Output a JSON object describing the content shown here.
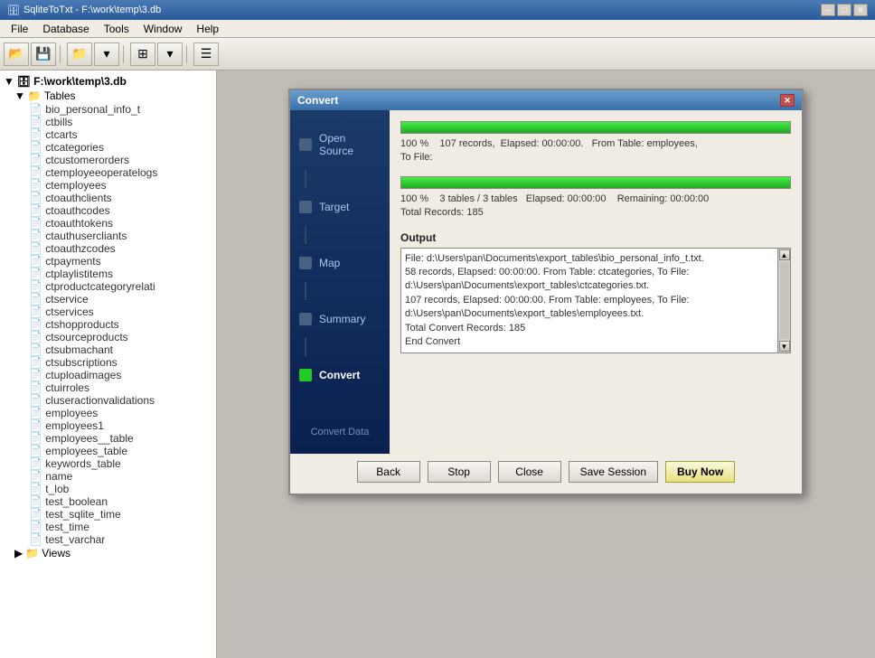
{
  "app": {
    "title": "SqliteToTxt - F:\\work\\temp\\3.db",
    "icon": "🗄"
  },
  "titlebar": {
    "minimize_label": "─",
    "maximize_label": "□",
    "close_label": "✕"
  },
  "menu": {
    "items": [
      "File",
      "Database",
      "Tools",
      "Window",
      "Help"
    ]
  },
  "toolbar": {
    "buttons": [
      "open",
      "save",
      "folder",
      "grid"
    ]
  },
  "tree": {
    "db_label": "F:\\work\\temp\\3.db",
    "tables_label": "Tables",
    "tables": [
      "bio_personal_info_t",
      "ctbills",
      "ctcarts",
      "ctcategories",
      "ctcustomerorders",
      "ctemployeeoperatelogs",
      "ctemployees",
      "ctoauthclients",
      "ctoauthcodes",
      "ctoauthtokens",
      "ctauthusercliants",
      "ctoauthzcodes",
      "ctpayments",
      "ctplaylistitems",
      "ctproductcategoryrelati",
      "ctservice",
      "ctservices",
      "ctshopproducts",
      "ctsourceproducts",
      "ctsubmachant",
      "ctsubscriptions",
      "ctuploadimages",
      "ctuirroles",
      "cluseractionvalidations",
      "employees",
      "employees1",
      "employees__table",
      "employees_table",
      "keywords_table",
      "name",
      "t_lob",
      "test_boolean",
      "test_sqlite_time",
      "test_time",
      "test_varchar"
    ],
    "views_label": "Views"
  },
  "modal": {
    "title": "Convert",
    "close_label": "✕",
    "nav_steps": [
      {
        "id": "open-source",
        "label": "Open Source",
        "active": false
      },
      {
        "id": "target",
        "label": "Target",
        "active": false
      },
      {
        "id": "map",
        "label": "Map",
        "active": false
      },
      {
        "id": "summary",
        "label": "Summary",
        "active": false
      },
      {
        "id": "convert",
        "label": "Convert",
        "active": true
      }
    ],
    "convert_data_label": "Convert Data",
    "progress1": {
      "percent": 100,
      "text_line1": "100 %     107 records,  Elapsed: 00:00:00.   From Table: employees,",
      "text_line2": "To File:"
    },
    "progress2": {
      "percent": 100,
      "text_line1": "100 %     3 tables / 3 tables   Elapsed: 00:00:00    Remaining: 00:00:00",
      "text_line2": "Total Records: 185"
    },
    "output": {
      "label": "Output",
      "text": "File: d:\\Users\\pan\\Documents\\export_tables\\bio_personal_info_t.txt.\n58 records,  Elapsed: 00:00:00.   From Table: ctcategories,  To File: d:\\Users\\pan\\Documents\\export_tables\\ctcategories.txt.\n107 records,  Elapsed: 00:00:00.   From Table: employees,   To File: d:\\Users\\pan\\Documents\\export_tables\\employees.txt.\nTotal Convert Records: 185\nEnd Convert"
    },
    "buttons": {
      "back": "Back",
      "stop": "Stop",
      "close": "Close",
      "save_session": "Save Session",
      "buy_now": "Buy Now"
    }
  }
}
